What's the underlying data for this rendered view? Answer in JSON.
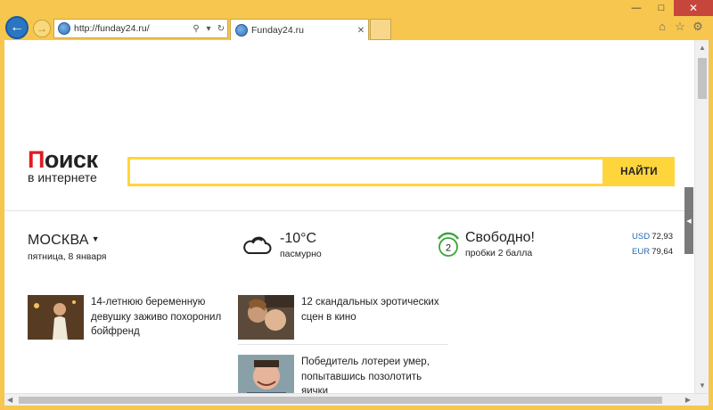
{
  "browser": {
    "address_url": "http://funday24.ru/",
    "tab_title": "Funday24.ru",
    "window_controls": [
      "—",
      "□",
      "✕"
    ]
  },
  "page": {
    "logo_title_first": "П",
    "logo_title_rest": "оиск",
    "logo_subtitle": "в интернете",
    "search_button": "НАЙТИ",
    "city": "МОСКВА",
    "date": "пятница, 8 января",
    "weather_temp": "-10°C",
    "weather_condition": "пасмурно",
    "traffic_level": "2",
    "traffic_title": "Свободно!",
    "traffic_sub": "пробки 2 балла",
    "rates": [
      {
        "code": "USD",
        "value": "72,93"
      },
      {
        "code": "EUR",
        "value": "79,64"
      }
    ],
    "news": [
      {
        "text": "14-летнюю беременную девушку заживо похоронил бойфренд"
      },
      {
        "text": "12 скандальных эротических сцен в кино"
      },
      {
        "text": "Победитель лотереи умер, попытавшись позолотить яички"
      }
    ]
  },
  "colors": {
    "frame": "#f6c64f",
    "search_accent": "#ffd53c",
    "logo_red": "#e01b22",
    "link_blue": "#2a6ab2"
  }
}
